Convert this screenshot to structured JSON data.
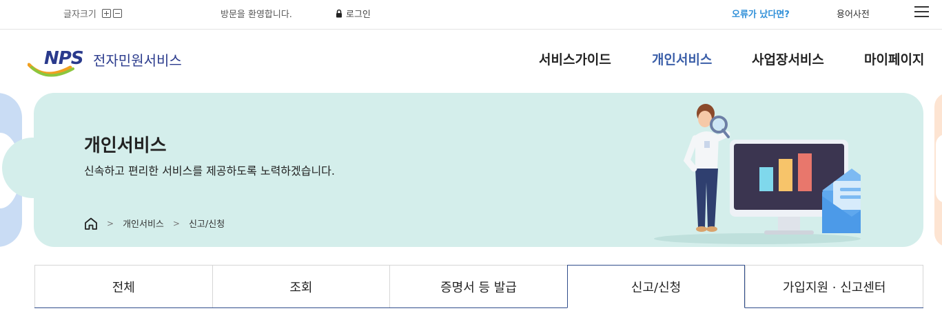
{
  "utility": {
    "font_size_label": "글자크기",
    "welcome": "방문을 환영합니다.",
    "login": "로그인",
    "error_report": "오류가 났다면?",
    "glossary": "용어사전"
  },
  "header": {
    "logo_mark": "NPS",
    "service_name": "전자민원서비스",
    "nav": [
      {
        "label": "서비스가이드"
      },
      {
        "label": "개인서비스"
      },
      {
        "label": "사업장서비스"
      },
      {
        "label": "마이페이지"
      }
    ]
  },
  "hero": {
    "title": "개인서비스",
    "subtitle": "신속하고 편리한 서비스를 제공하도록 노력하겠습니다.",
    "breadcrumb": [
      "개인서비스",
      "신고/신청"
    ]
  },
  "tabs": [
    {
      "label": "전체"
    },
    {
      "label": "조회"
    },
    {
      "label": "증명서 등 발급"
    },
    {
      "label": "신고/신청"
    },
    {
      "label": "가입지원 · 신고센터"
    }
  ],
  "colors": {
    "accent_blue": "#3a5ea8",
    "error_link": "#2f8fd8",
    "hero_bg": "#d4eeeb",
    "tab_border": "#2f4c8a"
  }
}
